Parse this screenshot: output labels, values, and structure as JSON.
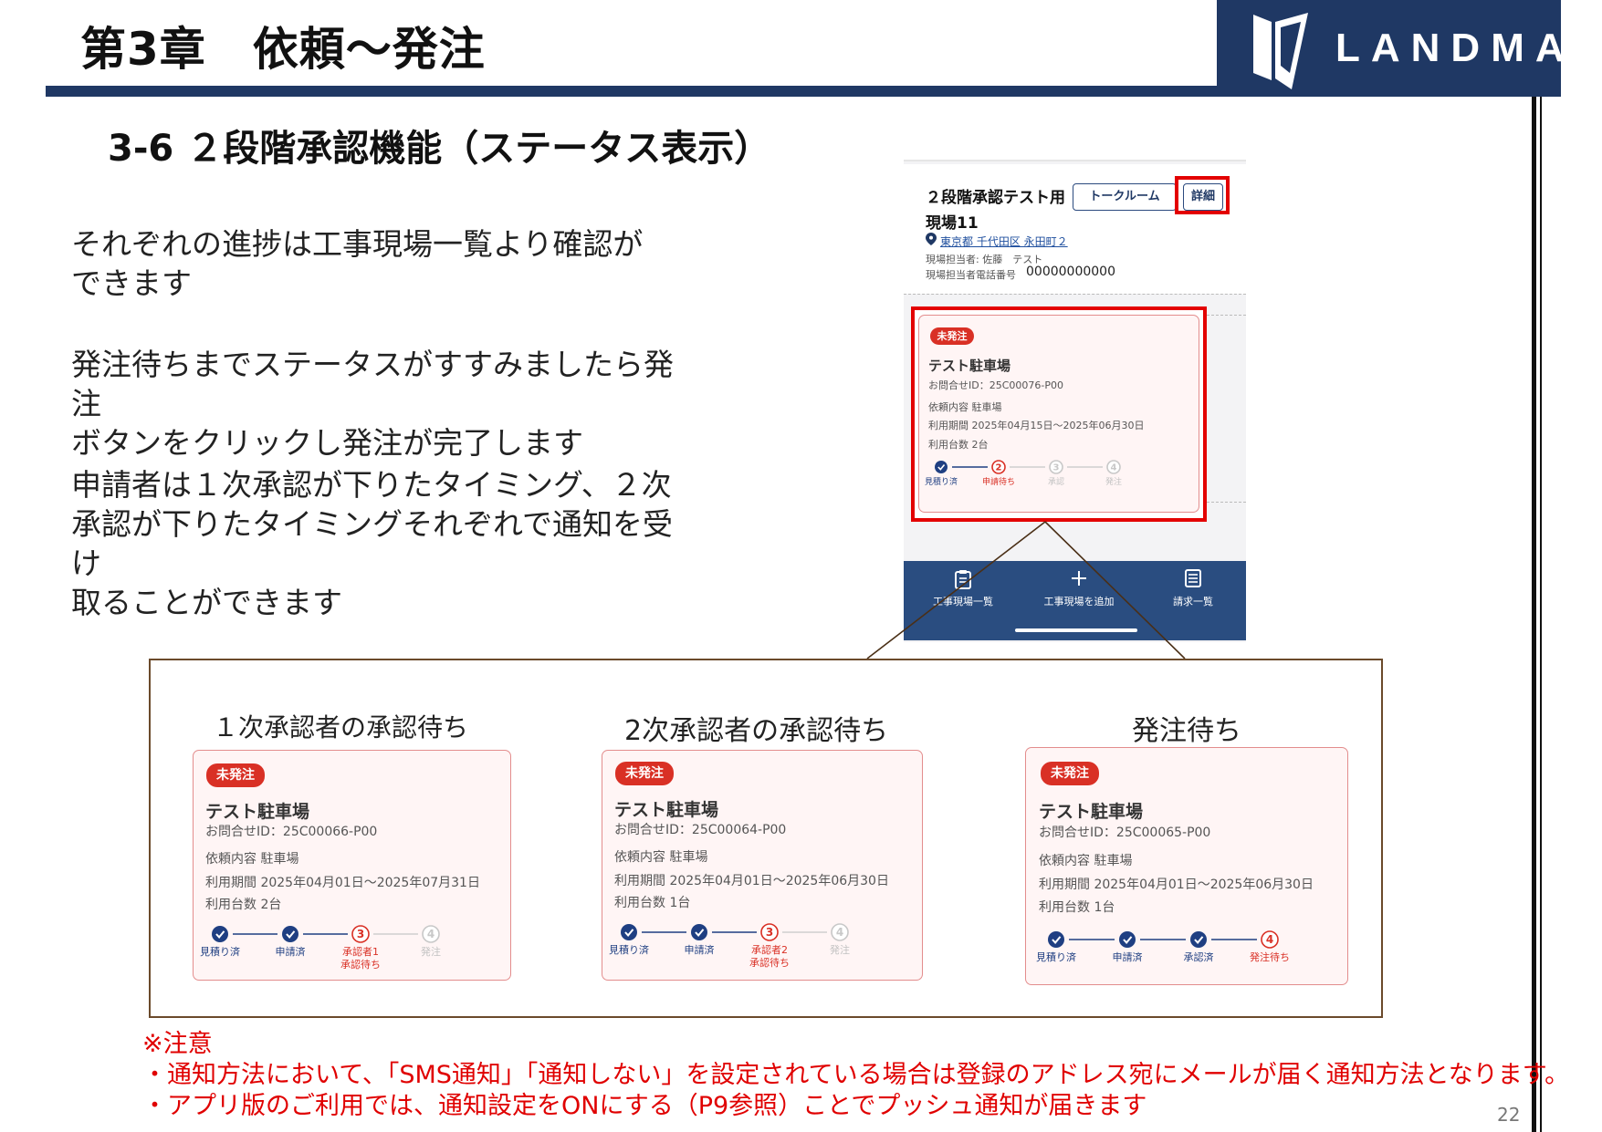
{
  "header": {
    "chapter_title": "第3章　依頼～発注",
    "logo_text": "LANDMARK",
    "section_title": "3-6 ２段階承認機能（ステータス表示）"
  },
  "body": {
    "paragraphs": [
      [
        "それぞれの進捗は工事現場一覧より確認が",
        "できます"
      ],
      [
        "発注待ちまでステータスがすすみましたら発注",
        "ボタンをクリックし発注が完了します"
      ],
      [
        "申請者は１次承認が下りたタイミング、２次",
        "承認が下りたタイミングそれぞれで通知を受け",
        "取ることができます"
      ]
    ]
  },
  "phone": {
    "site_title": "２段階承認テスト用",
    "site_name": "現場11",
    "talk_room_button": "トークルーム",
    "detail_button": "詳細",
    "address": "東京都 千代田区 永田町２",
    "manager": "現場担当者: 佐藤　テスト",
    "phone_label": "現場担当者電話番号",
    "phone_value": "00000000000",
    "card": {
      "badge": "未発注",
      "title": "テスト駐車場",
      "inquiry_id": "お問合せID：25C00076-P00",
      "request": "依頼内容 駐車場",
      "period": "利用期間 2025年04月15日～2025年06月30日",
      "count": "利用台数 2台",
      "steps": [
        {
          "label": "見積り済",
          "state": "done",
          "num": "1"
        },
        {
          "label": "申請待ち",
          "state": "current",
          "num": "2"
        },
        {
          "label": "承認",
          "state": "pending",
          "num": "3"
        },
        {
          "label": "発注",
          "state": "pending",
          "num": "4"
        }
      ]
    },
    "nav": [
      {
        "label": "工事現場一覧",
        "icon": "clipboard-icon"
      },
      {
        "label": "工事現場を追加",
        "icon": "plus-icon"
      },
      {
        "label": "請求一覧",
        "icon": "list-icon"
      }
    ]
  },
  "columns": [
    {
      "heading": "１次承認者の承認待ち",
      "card": {
        "badge": "未発注",
        "title": "テスト駐車場",
        "inquiry_id": "お問合せID：25C00066-P00",
        "request": "依頼内容 駐車場",
        "period": "利用期間 2025年04月01日～2025年07月31日",
        "count": "利用台数 2台",
        "steps": [
          {
            "label": "見積り済",
            "label2": "",
            "state": "done",
            "num": "1"
          },
          {
            "label": "申請済",
            "label2": "",
            "state": "done",
            "num": "2"
          },
          {
            "label": "承認者1",
            "label2": "承認待ち",
            "state": "current",
            "num": "3"
          },
          {
            "label": "発注",
            "label2": "",
            "state": "pending",
            "num": "4"
          }
        ]
      }
    },
    {
      "heading": "2次承認者の承認待ち",
      "card": {
        "badge": "未発注",
        "title": "テスト駐車場",
        "inquiry_id": "お問合せID：25C00064-P00",
        "request": "依頼内容 駐車場",
        "period": "利用期間 2025年04月01日～2025年06月30日",
        "count": "利用台数 1台",
        "steps": [
          {
            "label": "見積り済",
            "label2": "",
            "state": "done",
            "num": "1"
          },
          {
            "label": "申請済",
            "label2": "",
            "state": "done",
            "num": "2"
          },
          {
            "label": "承認者2",
            "label2": "承認待ち",
            "state": "current",
            "num": "3"
          },
          {
            "label": "発注",
            "label2": "",
            "state": "pending",
            "num": "4"
          }
        ]
      }
    },
    {
      "heading": "発注待ち",
      "card": {
        "badge": "未発注",
        "title": "テスト駐車場",
        "inquiry_id": "お問合せID：25C00065-P00",
        "request": "依頼内容 駐車場",
        "period": "利用期間 2025年04月01日～2025年06月30日",
        "count": "利用台数 1台",
        "steps": [
          {
            "label": "見積り済",
            "label2": "",
            "state": "done",
            "num": "1"
          },
          {
            "label": "申請済",
            "label2": "",
            "state": "done",
            "num": "2"
          },
          {
            "label": "承認済",
            "label2": "",
            "state": "done",
            "num": "3"
          },
          {
            "label": "発注待ち",
            "label2": "",
            "state": "current",
            "num": "4"
          }
        ]
      }
    }
  ],
  "notes": [
    "※注意",
    "・通知方法において、「SMS通知」「通知しない」を設定されている場合は登録のアドレス宛にメールが届く通知方法となります。",
    "・アプリ版のご利用では、通知設定をONにする（P9参照）ことでプッシュ通知が届きます"
  ],
  "page_number": "22",
  "colors": {
    "navy": "#1f3864",
    "nav_blue": "#2a4d80",
    "alert_red": "#e30000",
    "badge_red": "#d93025",
    "step_done": "#1f3f82",
    "step_current": "#d93025"
  }
}
